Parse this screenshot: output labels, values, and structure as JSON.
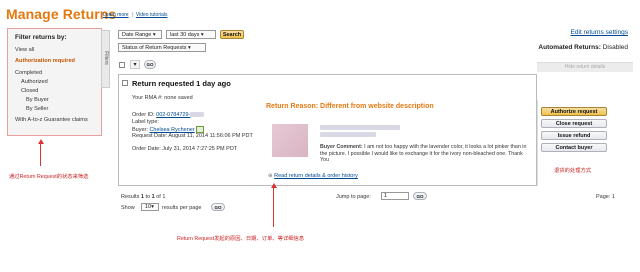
{
  "header": {
    "title": "Manage Returns",
    "learn_more": "Learn more",
    "separator": "|",
    "video_tutorials": "Video tutorials"
  },
  "filters": {
    "title": "Filter returns by:",
    "tab_label": "Filters",
    "items": {
      "view_all": "View all",
      "authorization_required": "Authorization required",
      "completed": "Completed",
      "authorized": "Authorized",
      "closed": "Closed",
      "by_buyer": "By Buyer",
      "by_seller": "By Seller",
      "a_to_z": "With A-to-z Guarantee claims"
    }
  },
  "toolbar": {
    "date_range": "Date Range",
    "period": "last 30 days",
    "search_label": "Search",
    "status_select": "Status of Return Requests",
    "go_label": "GO"
  },
  "settings": {
    "edit_link": "Edit returns settings",
    "automated_label": "Automated Returns:",
    "automated_value": "Disabled"
  },
  "action_header": "Hide return details",
  "request": {
    "title": "Return requested 1 day ago",
    "rma": "Your RMA #: none saved",
    "order_id_label": "Order ID:",
    "order_id": "002-0784729-",
    "label_type": "Label type:",
    "buyer_label": "Buyer:",
    "buyer_name": "Chelsea Rychener",
    "request_date": "Request Date: August 11, 2014 11:56:06 PM PDT",
    "order_date": "Order Date: July 31, 2014 7:27:25 PM PDT",
    "reason": "Return Reason: Different from website description",
    "buyer_comment_label": "Buyer Comment:",
    "buyer_comment": "I am not too happy with the lavender color, it looks a lot pinker than in the picture. I possible I would like to exchange it for the ivory non-bleached one. Thank You",
    "details_link": "Read return details & order history"
  },
  "actions": [
    "Authorize request",
    "Close request",
    "Issue refund",
    "Contact buyer"
  ],
  "pagination": {
    "results_prefix": "Results",
    "results_from": "1",
    "results_to_word": "to",
    "results_to": "1",
    "results_of_word": "of",
    "results_total": "1",
    "jump_label": "Jump to page:",
    "jump_value": "1",
    "page_label": "Page:",
    "page_value": "1",
    "show_label": "Show",
    "show_value": "10",
    "per_page_label": "results per page"
  },
  "annotations": {
    "filter_note": "通过Return Request的状态来筛选",
    "detail_note": "Return Request发起的原因、日期、订单、等详细信息",
    "action_note": "退货的处理方式"
  },
  "colors": {
    "title_orange": "#e47911",
    "link_blue": "#004b91",
    "annotation_red": "#cc2222"
  }
}
